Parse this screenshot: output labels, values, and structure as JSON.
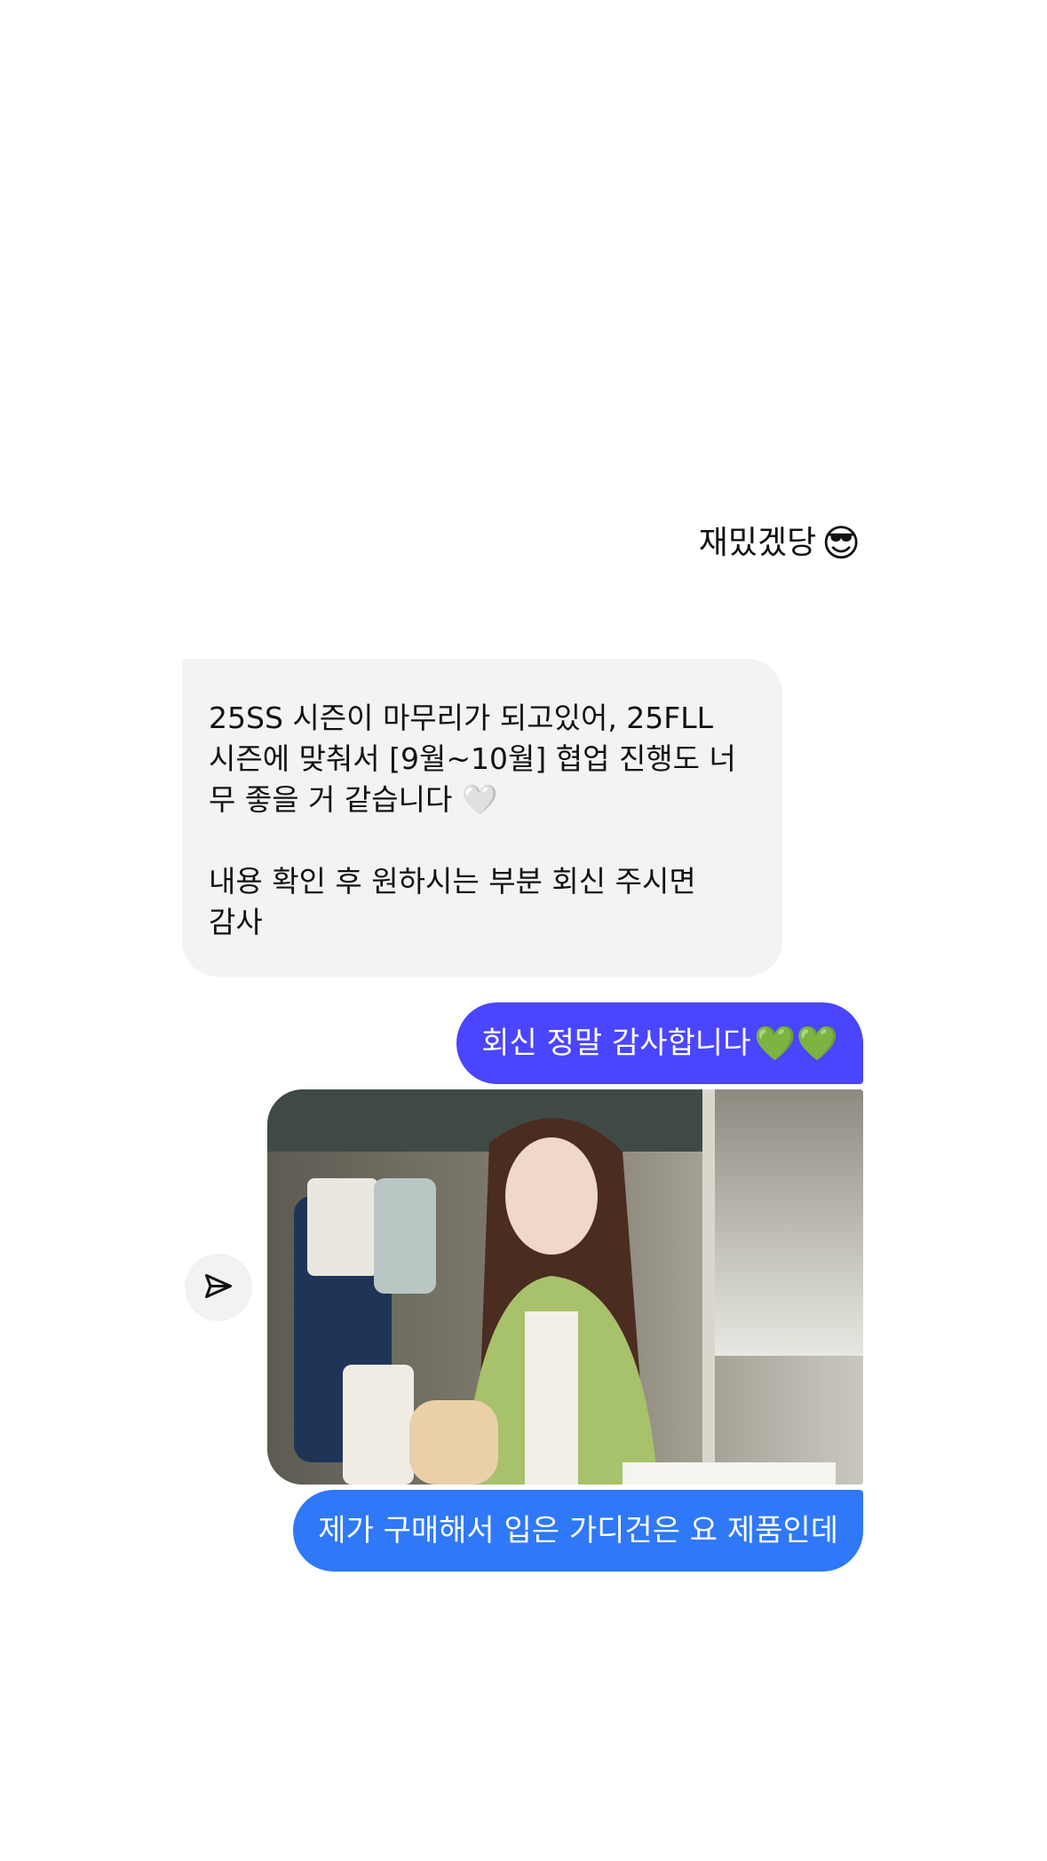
{
  "messages": {
    "plain_outgoing": {
      "text": "재밌겠당",
      "emoji": "😎"
    },
    "incoming": {
      "line1": "25SS 시즌이 마무리가 되고있어, 25FLL",
      "line2": "시즌에 맞춰서 [9월~10월] 협업 진행도 너",
      "line3": "무 좋을 거 같습니다 🤍",
      "line4": "내용 확인 후 원하시는 부분 회신 주시면",
      "line5": "감사"
    },
    "outgoing_1": {
      "text": "회신 정말 감사합니다",
      "emoji": "💚💚"
    },
    "photo": {
      "icon": "photo-attachment"
    },
    "outgoing_2": {
      "text": "제가 구매해서 입은 가디건은 요 제품인데"
    }
  },
  "actions": {
    "share_icon": "send-icon"
  },
  "colors": {
    "bubble_primary": "#4a45ff",
    "bubble_secondary": "#2f78f7",
    "bubble_incoming": "#f2f3f5"
  }
}
